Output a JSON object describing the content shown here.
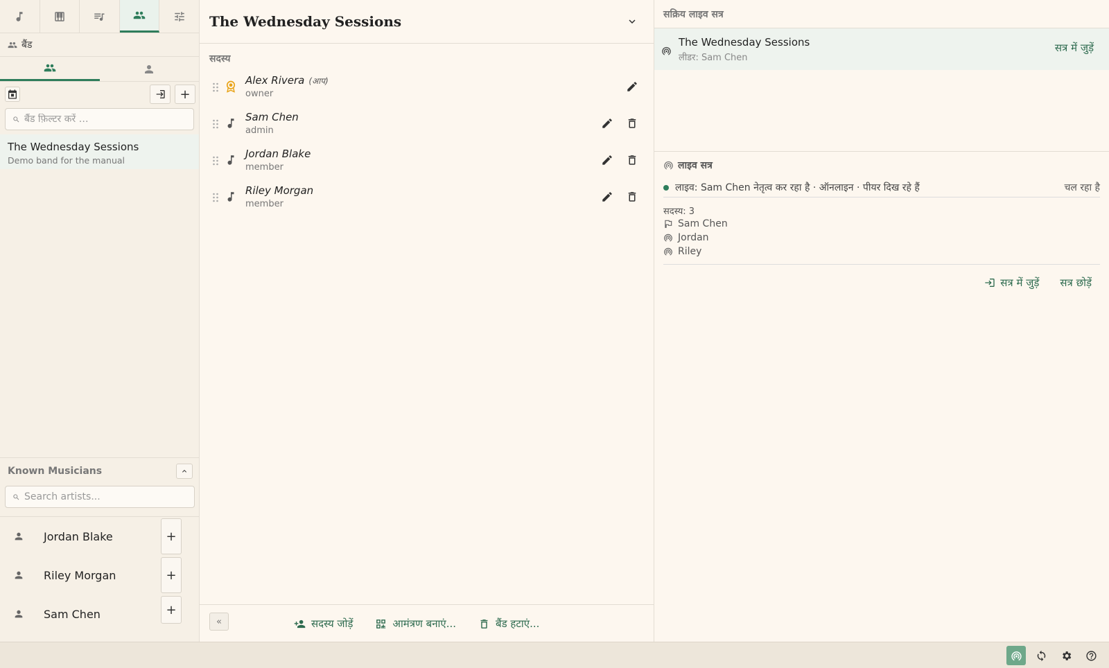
{
  "left": {
    "tabs": [
      {
        "icon": "music-note-icon"
      },
      {
        "icon": "piano-icon"
      },
      {
        "icon": "queue-music-icon"
      },
      {
        "icon": "group-icon"
      },
      {
        "icon": "tune-icon"
      }
    ],
    "section_title": "बैंड",
    "filter_placeholder": "बैंड फ़िल्टर करें …",
    "bands": [
      {
        "name": "The Wednesday Sessions",
        "subtitle": "Demo band for the manual"
      }
    ],
    "known_musicians": {
      "title": "Known Musicians",
      "search_placeholder": "Search artists...",
      "items": [
        {
          "name": "Jordan Blake"
        },
        {
          "name": "Riley Morgan"
        },
        {
          "name": "Sam Chen"
        }
      ]
    }
  },
  "middle": {
    "title": "The Wednesday Sessions",
    "members_label": "सदस्य",
    "members": [
      {
        "name": "Alex Rivera",
        "you": "(आप)",
        "role": "owner"
      },
      {
        "name": "Sam Chen",
        "role": "admin"
      },
      {
        "name": "Jordan Blake",
        "role": "member"
      },
      {
        "name": "Riley Morgan",
        "role": "member"
      }
    ],
    "footer": {
      "collapse": "«",
      "add_member": "सदस्य जोड़ें",
      "create_invite": "आमंत्रण बनाएं...",
      "delete_band": "बैंड हटाएं..."
    }
  },
  "right": {
    "active_title": "सक्रिय लाइव सत्र",
    "active_session": {
      "name": "The Wednesday Sessions",
      "leader": "लीडर: Sam Chen",
      "join": "सत्र में जुड़ें"
    },
    "live": {
      "title": "लाइव सत्र",
      "status": "लाइव: Sam Chen नेतृत्व कर रहा है  ·  ऑनलाइन · पीयर दिख रहे हैं",
      "running": "चल रहा है",
      "count": "सदस्य: 3",
      "peers": [
        "Sam Chen",
        "Jordan",
        "Riley"
      ],
      "join": "सत्र में जुड़ें",
      "leave": "सत्र छोड़ें"
    }
  },
  "colors": {
    "accent": "#2e7d5b",
    "background": "#fdf7ef",
    "selected": "#eef3ee"
  }
}
